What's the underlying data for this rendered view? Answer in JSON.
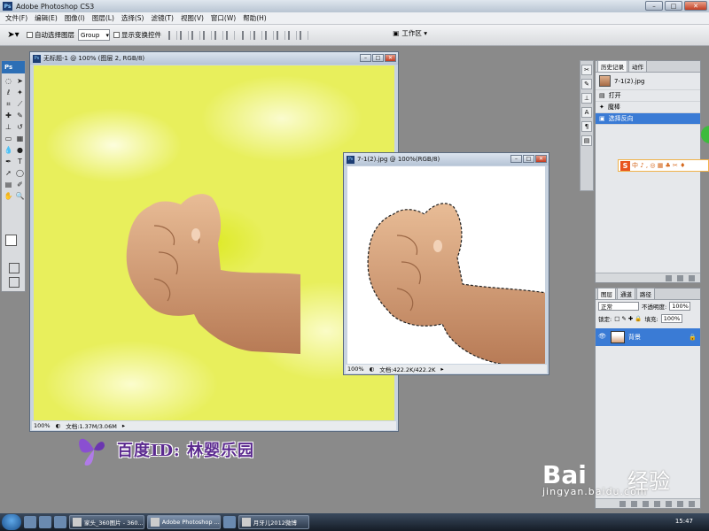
{
  "app": {
    "title": "Adobe Photoshop CS3",
    "logo": "Ps"
  },
  "menu": [
    "文件(F)",
    "编辑(E)",
    "图像(I)",
    "图层(L)",
    "选择(S)",
    "滤镜(T)",
    "视图(V)",
    "窗口(W)",
    "帮助(H)"
  ],
  "options": {
    "auto_select_label": "自动选择图层",
    "group_value": "Group",
    "show_transform_label": "显示变换控件",
    "workspace_label": "工作区 ▾"
  },
  "doc1": {
    "title": "无标题-1 @ 100% (图层 2, RGB/8)",
    "zoom": "100%",
    "doc_info": "文档:1.37M/3.06M"
  },
  "doc2": {
    "title": "7-1(2).jpg @ 100%(RGB/8)",
    "zoom": "100%",
    "doc_info": "文档:422.2K/422.2K"
  },
  "history": {
    "tabs": [
      "历史记录",
      "动作"
    ],
    "snapshot": "7-1(2).jpg",
    "items": [
      "打开",
      "魔棒",
      "选择反向"
    ],
    "selected_index": 2
  },
  "layers": {
    "tabs": [
      "图层",
      "通道",
      "路径"
    ],
    "blend_mode": "正常",
    "opacity_label": "不透明度:",
    "opacity_value": "100%",
    "lock_label": "锁定:",
    "fill_label": "填充:",
    "fill_value": "100%",
    "layer_name": "背景"
  },
  "watermark": {
    "text": "百度ID: 林婴乐园"
  },
  "baidu": {
    "logo": "Bai",
    "logo_cn": "经验",
    "url": "jingyan.baidu.com"
  },
  "taskbar": {
    "tasks": [
      "家头_360图片 - 360...",
      "Adobe Photoshop ...",
      "月牙儿2012微博"
    ],
    "active_task_index": 1,
    "clock": "15:47"
  },
  "colors": {
    "foreground": "#ffffff",
    "background": "#e1ea00",
    "selection": "#3a7bd5",
    "canvas_yellow": "#e8ef5c"
  }
}
